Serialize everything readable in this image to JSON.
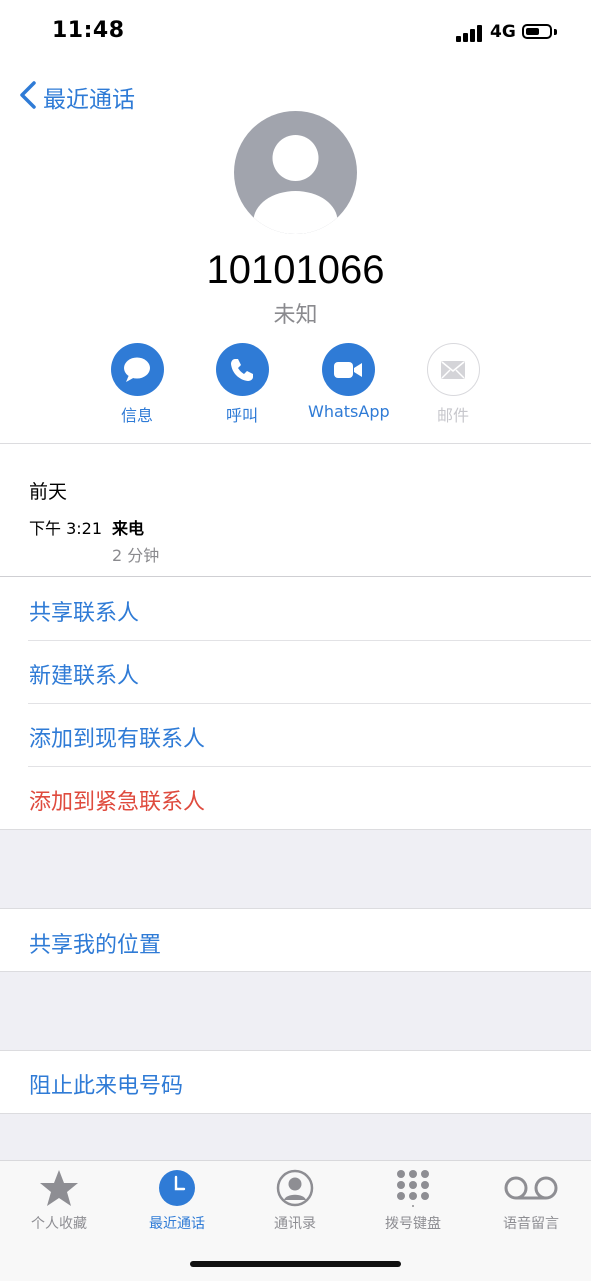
{
  "status_bar": {
    "time": "11:48",
    "network": "4G",
    "battery_level": 0.6
  },
  "nav": {
    "back_label": "最近通话"
  },
  "contact": {
    "number": "10101066",
    "label": "未知"
  },
  "actions": [
    {
      "label": "信息",
      "icon": "message-icon",
      "enabled": true
    },
    {
      "label": "呼叫",
      "icon": "phone-icon",
      "enabled": true
    },
    {
      "label": "WhatsApp",
      "icon": "video-icon",
      "enabled": true
    },
    {
      "label": "邮件",
      "icon": "mail-icon",
      "enabled": false
    }
  ],
  "call_log": {
    "day": "前天",
    "time": "下午 3:21",
    "type": "来电",
    "duration": "2 分钟"
  },
  "options": {
    "share_contact": "共享联系人",
    "new_contact": "新建联系人",
    "add_existing": "添加到现有联系人",
    "add_emergency": "添加到紧急联系人",
    "share_location": "共享我的位置",
    "block_caller": "阻止此来电号码"
  },
  "tabs": [
    {
      "label": "个人收藏",
      "icon": "star-icon"
    },
    {
      "label": "最近通话",
      "icon": "clock-icon",
      "active": true
    },
    {
      "label": "通讯录",
      "icon": "person-circle-icon"
    },
    {
      "label": "拨号键盘",
      "icon": "keypad-icon"
    },
    {
      "label": "语音留言",
      "icon": "voicemail-icon"
    }
  ],
  "colors": {
    "accent": "#2f7bd6",
    "danger": "#df4b3e",
    "avatar": "#a1a4ad",
    "group_bg": "#efeff4"
  }
}
